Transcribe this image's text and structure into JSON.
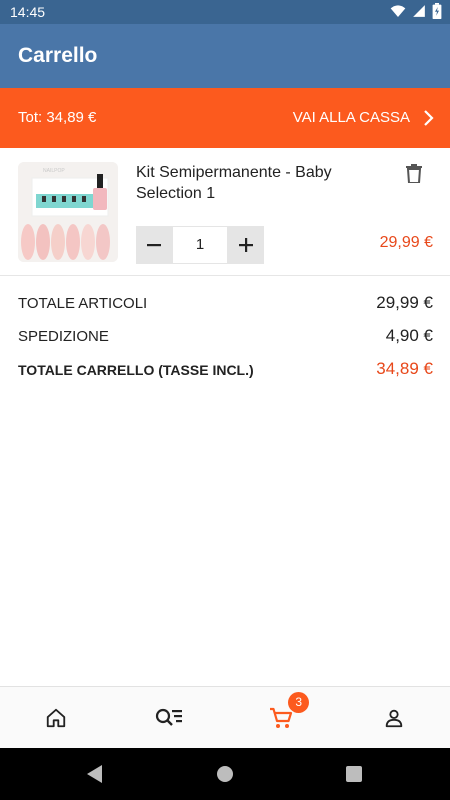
{
  "status_bar": {
    "time": "14:45"
  },
  "app_bar": {
    "title": "Carrello"
  },
  "checkout_bar": {
    "total": "Tot: 34,89 €",
    "cta": "VAI ALLA CASSA"
  },
  "cart_item": {
    "name": "Kit Semipermanente - Baby Selection 1",
    "quantity": "1",
    "price": "29,99 €",
    "image_brand_text": "NAILPOP"
  },
  "summary": {
    "subtotal_label": "TOTALE ARTICOLI",
    "subtotal_value": "29,99 €",
    "shipping_label": "SPEDIZIONE",
    "shipping_value": "4,90 €",
    "total_label": "TOTALE CARRELLO (TASSE INCL.)",
    "total_value": "34,89 €"
  },
  "bottom_nav": {
    "cart_badge": "3",
    "items": [
      "home-icon",
      "search-list-icon",
      "cart-icon",
      "account-icon"
    ],
    "active": "cart-icon"
  },
  "colors": {
    "app_bar": "#4a76a8",
    "status_bar": "#3a6591",
    "accent": "#fc5a1e",
    "price": "#e8481a"
  }
}
